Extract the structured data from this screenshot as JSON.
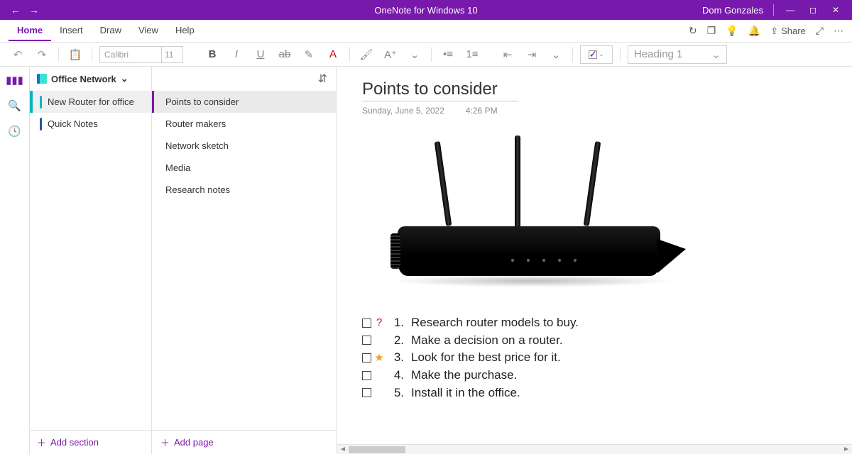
{
  "titlebar": {
    "appTitle": "OneNote for Windows 10",
    "user": "Dom Gonzales"
  },
  "tabs": [
    "Home",
    "Insert",
    "Draw",
    "View",
    "Help"
  ],
  "activeTab": 0,
  "shareLabel": "Share",
  "ribbon": {
    "fontName": "Calibri",
    "fontSize": "11",
    "headingStyle": "Heading 1"
  },
  "notebook": {
    "name": "Office Network",
    "sections": [
      "New Router for office",
      "Quick Notes"
    ],
    "selected": 0,
    "addSection": "Add section"
  },
  "pages": {
    "items": [
      "Points to consider",
      "Router makers",
      "Network sketch",
      "Media",
      "Research notes"
    ],
    "selected": 0,
    "addPage": "Add page"
  },
  "page": {
    "title": "Points to consider",
    "date": "Sunday, June 5, 2022",
    "time": "4:26 PM",
    "todos": [
      {
        "tag": "question",
        "n": "1.",
        "text": "Research router models to buy."
      },
      {
        "tag": "",
        "n": "2.",
        "text": "Make a decision on a router."
      },
      {
        "tag": "star",
        "n": "3.",
        "text": "Look for the best price for it."
      },
      {
        "tag": "",
        "n": "4.",
        "text": "Make the purchase."
      },
      {
        "tag": "",
        "n": "5.",
        "text": "Install it in the office."
      }
    ]
  }
}
